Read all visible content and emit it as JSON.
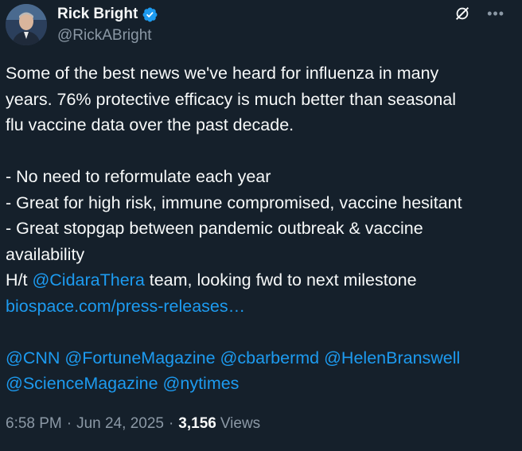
{
  "author": {
    "display_name": "Rick Bright",
    "handle": "@RickABright",
    "verified_icon": "verified-badge-icon",
    "badge_color": "#1d9bf0"
  },
  "tweet": {
    "line1": "Some of the best news we've heard for influenza in many",
    "line2": "years. 76% protective efficacy is much better than seasonal",
    "line3": "flu vaccine data over the past decade.",
    "bullet1": "- No need to reformulate each year",
    "bullet2": "- Great for high risk, immune compromised, vaccine hesitant",
    "bullet3a": "- Great stopgap between pandemic outbreak & vaccine",
    "bullet3b": "availability",
    "ht_prefix": "H/t ",
    "ht_mention": "@CidaraThera",
    "ht_suffix": " team, looking fwd to next milestone",
    "link": "biospace.com/press-releases…",
    "mentions_line1": [
      "@CNN",
      "@FortuneMagazine",
      "@cbarbermd",
      "@HelenBranswell"
    ],
    "mentions_line2": [
      "@ScienceMagazine",
      "@nytimes"
    ]
  },
  "meta": {
    "time": "6:58 PM",
    "separator": "·",
    "date": "Jun 24, 2025",
    "views_count": "3,156",
    "views_label": "Views"
  },
  "colors": {
    "background": "#15202b",
    "text": "#f7f9f9",
    "secondary": "#8b98a5",
    "link": "#1d9bf0"
  }
}
